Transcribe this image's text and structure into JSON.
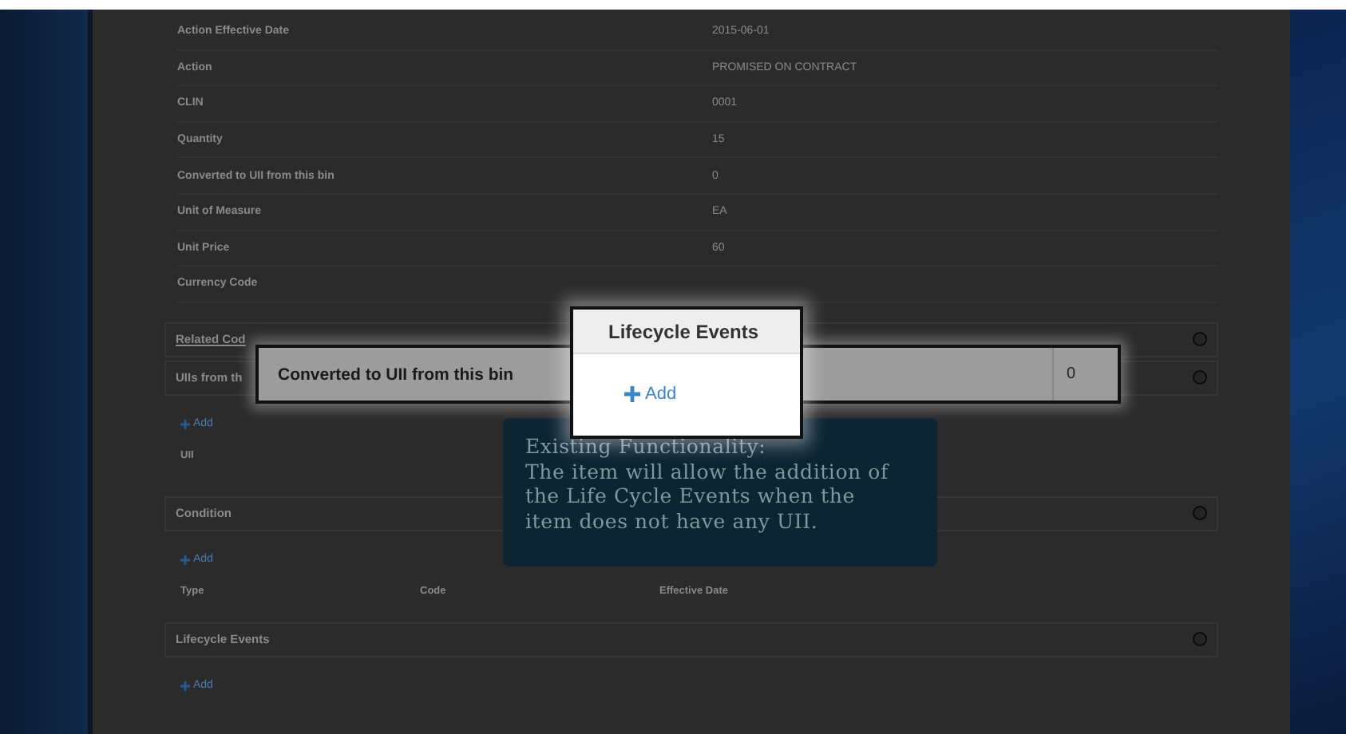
{
  "fields": [
    {
      "label": "Action Effective Date",
      "value": "2015-06-01"
    },
    {
      "label": "Action",
      "value": "PROMISED ON CONTRACT"
    },
    {
      "label": "CLIN",
      "value": "0001"
    },
    {
      "label": "Quantity",
      "value": "15"
    },
    {
      "label": "Converted to UII from this bin",
      "value": "0"
    },
    {
      "label": "Unit of Measure",
      "value": "EA"
    },
    {
      "label": "Unit Price",
      "value": "60"
    },
    {
      "label": "Currency Code"
    }
  ],
  "related_section": {
    "title": "Related Cod"
  },
  "uiis_section": {
    "title": "UIIs from th",
    "add": "Add",
    "column": "UII"
  },
  "condition_section": {
    "title": "Condition",
    "add": "Add",
    "columns": [
      "Type",
      "Code",
      "Effective Date"
    ]
  },
  "lifecycle_section": {
    "title": "Lifecycle Events",
    "add": "Add"
  },
  "highlight_row": {
    "label": "Converted to UII from this bin",
    "value": "0"
  },
  "popup": {
    "title": "Lifecycle Events",
    "add": "Add"
  },
  "tooltip": {
    "heading": "Existing Functionality:",
    "text": "The item will allow the addition of the Life Cycle Events when the item does not have any UII."
  }
}
